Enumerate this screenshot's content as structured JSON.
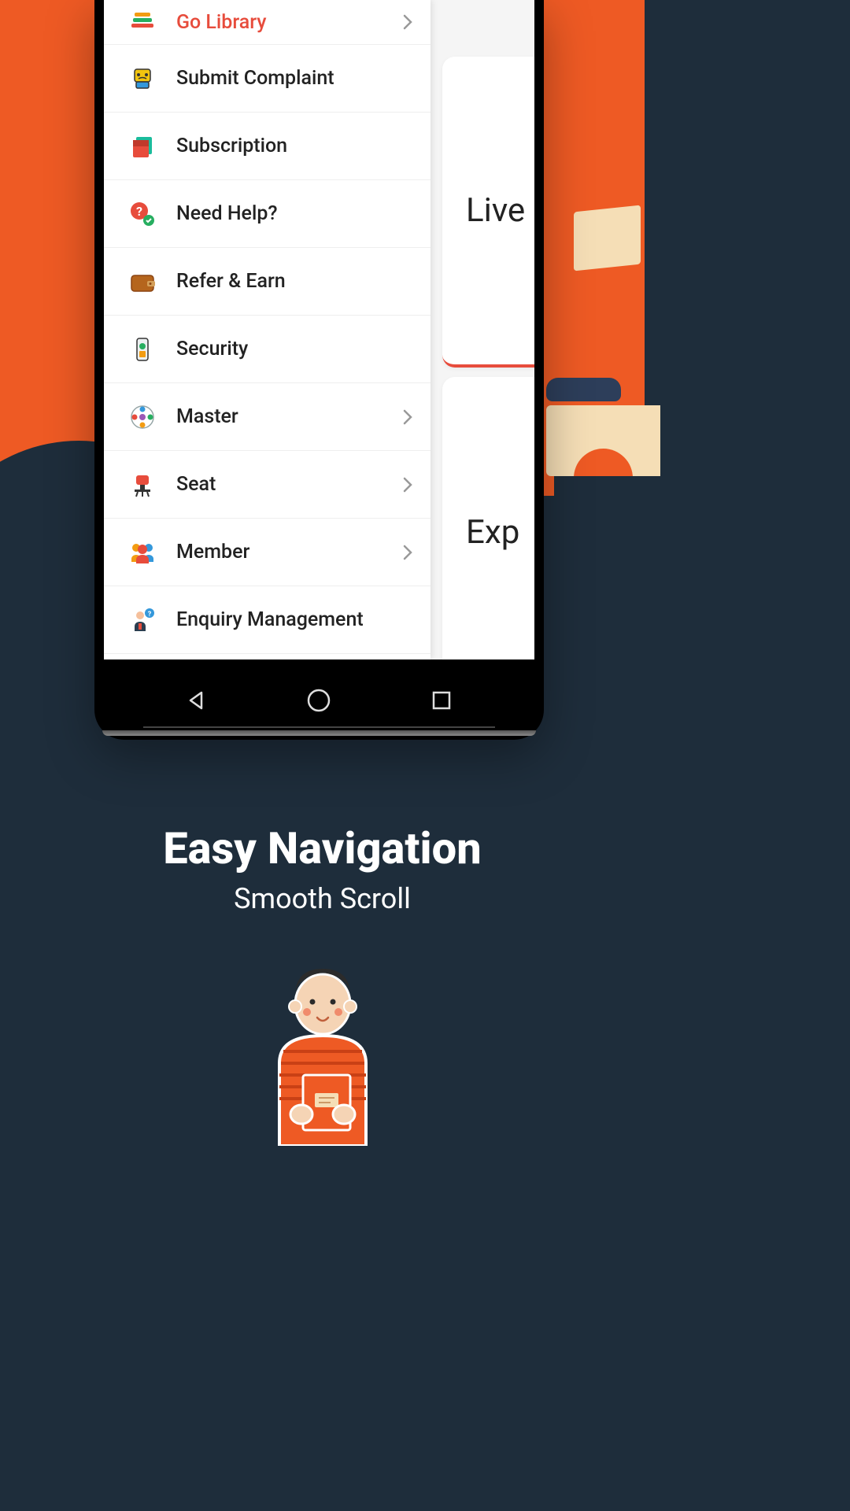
{
  "sidebar": {
    "items": [
      {
        "label": "Go Library",
        "active": true,
        "has_chevron": true,
        "icon": "books-icon"
      },
      {
        "label": "Submit Complaint",
        "active": false,
        "has_chevron": false,
        "icon": "complaint-icon"
      },
      {
        "label": "Subscription",
        "active": false,
        "has_chevron": false,
        "icon": "folder-icon"
      },
      {
        "label": "Need Help?",
        "active": false,
        "has_chevron": false,
        "icon": "help-icon"
      },
      {
        "label": "Refer & Earn",
        "active": false,
        "has_chevron": false,
        "icon": "wallet-icon"
      },
      {
        "label": "Security",
        "active": false,
        "has_chevron": false,
        "icon": "security-icon"
      },
      {
        "label": "Master",
        "active": false,
        "has_chevron": true,
        "icon": "master-icon"
      },
      {
        "label": "Seat",
        "active": false,
        "has_chevron": true,
        "icon": "seat-icon"
      },
      {
        "label": "Member",
        "active": false,
        "has_chevron": true,
        "icon": "member-icon"
      },
      {
        "label": "Enquiry Management",
        "active": false,
        "has_chevron": false,
        "icon": "enquiry-icon"
      }
    ]
  },
  "cards": {
    "card1": "Live",
    "card2": "Exp"
  },
  "headline": {
    "title": "Easy Navigation",
    "subtitle": "Smooth Scroll"
  },
  "colors": {
    "accent": "#e74c3c",
    "bg_orange": "#ee5a24",
    "bg_dark": "#1e2d3b"
  }
}
